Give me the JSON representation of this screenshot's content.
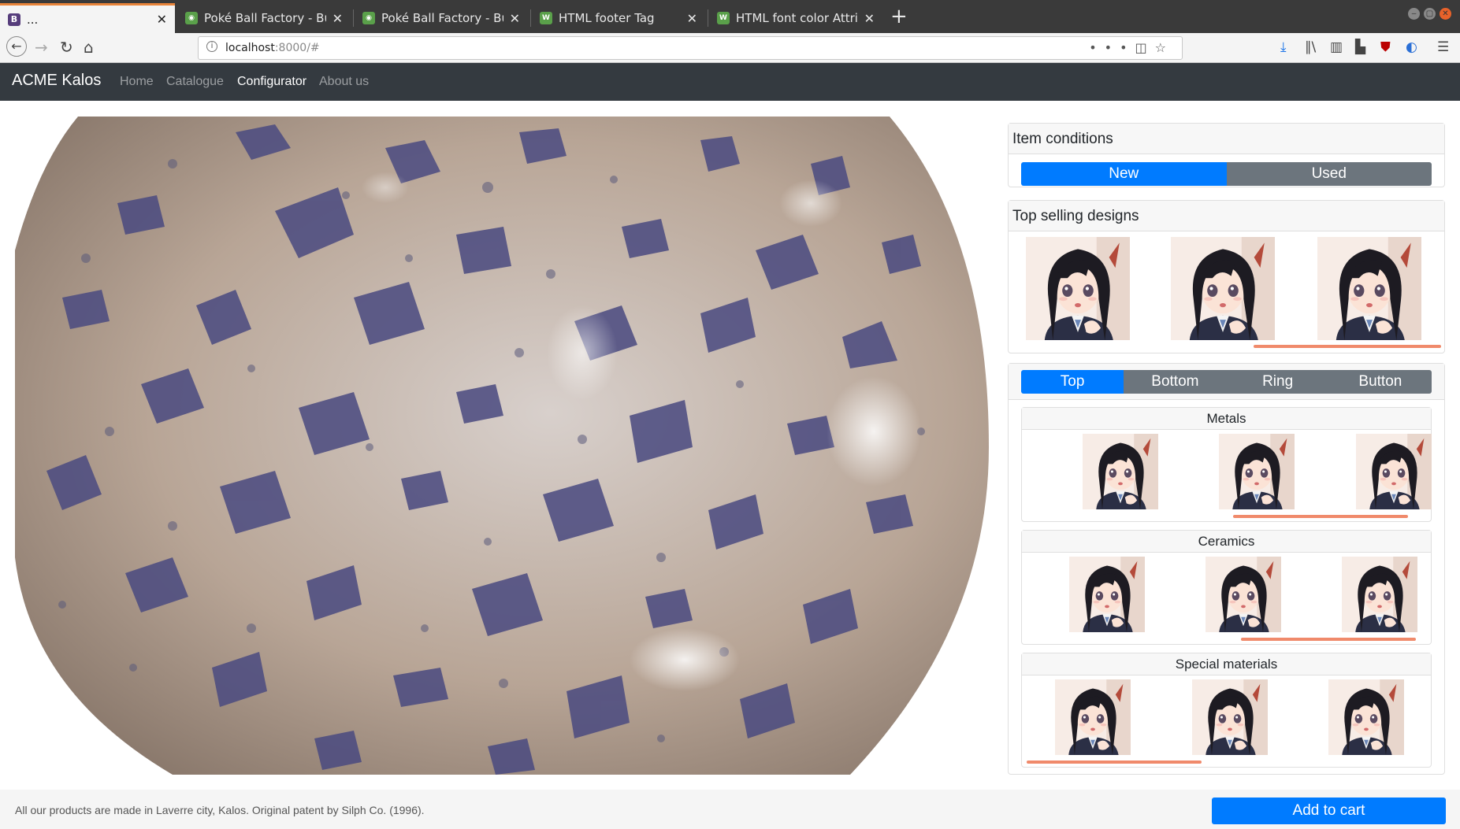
{
  "browser": {
    "tabs": [
      {
        "title": "...",
        "favicon": "bootstrap-icon",
        "active": true
      },
      {
        "title": "Poké Ball Factory - Bulba",
        "favicon": "bulbapedia-icon"
      },
      {
        "title": "Poké Ball Factory - Bulba",
        "favicon": "bulbapedia-icon"
      },
      {
        "title": "HTML footer Tag",
        "favicon": "w3schools-icon"
      },
      {
        "title": "HTML font color Attribu",
        "favicon": "w3schools-icon"
      }
    ],
    "url_host": "localhost",
    "url_rest": ":8000/#"
  },
  "site": {
    "brand": "ACME Kalos",
    "nav": [
      {
        "label": "Home",
        "active": false
      },
      {
        "label": "Catalogue",
        "active": false
      },
      {
        "label": "Configurator",
        "active": true
      },
      {
        "label": "About us",
        "active": false
      }
    ]
  },
  "panel": {
    "conditions": {
      "title": "Item conditions",
      "options": [
        "New",
        "Used"
      ],
      "selected": "New"
    },
    "top_selling": {
      "title": "Top selling designs"
    },
    "parts": {
      "tabs": [
        "Top",
        "Bottom",
        "Ring",
        "Button"
      ],
      "selected": "Top",
      "groups": [
        {
          "title": "Metals"
        },
        {
          "title": "Ceramics"
        },
        {
          "title": "Special materials"
        }
      ]
    }
  },
  "footer": {
    "text": "All our products are made in Laverre city, Kalos. Original patent by Silph Co. (1996).",
    "cart_button": "Add to cart"
  },
  "colors": {
    "primary": "#007bff",
    "secondary": "#6c757d",
    "navbar": "#343a40",
    "scroll_indicator": "#f08a6b"
  }
}
